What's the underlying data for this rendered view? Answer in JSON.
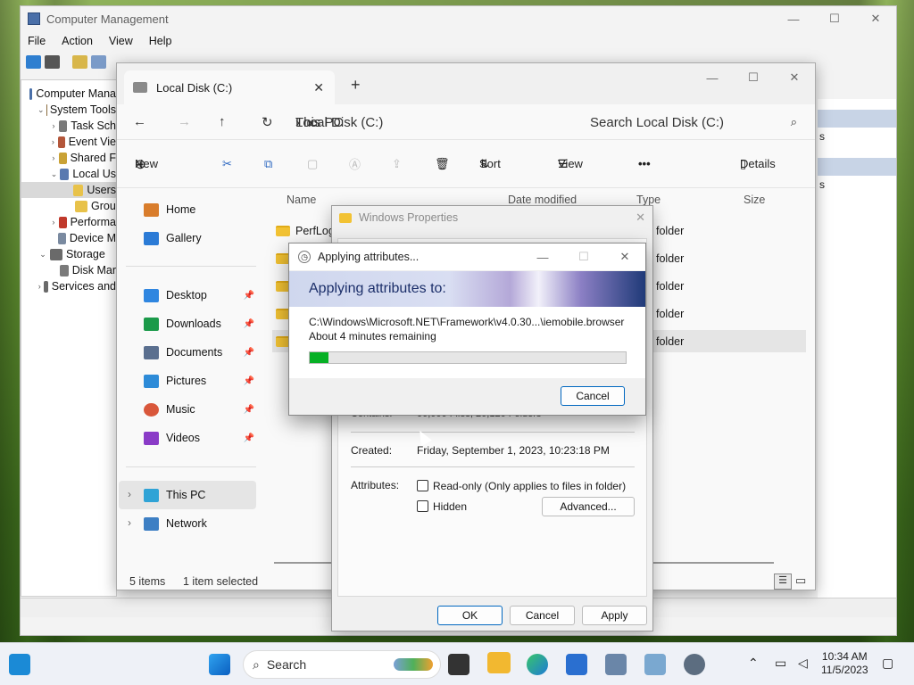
{
  "computer_management": {
    "title": "Computer Management",
    "menu": [
      "File",
      "Action",
      "View",
      "Help"
    ],
    "tree": [
      {
        "label": "Computer Mana",
        "indent": 0,
        "tw": ""
      },
      {
        "label": "System Tools",
        "indent": 1,
        "tw": "⌄"
      },
      {
        "label": "Task Sch",
        "indent": 2,
        "tw": "›"
      },
      {
        "label": "Event Vie",
        "indent": 2,
        "tw": "›"
      },
      {
        "label": "Shared F",
        "indent": 2,
        "tw": "›"
      },
      {
        "label": "Local Us",
        "indent": 2,
        "tw": "⌄"
      },
      {
        "label": "Users",
        "indent": 3,
        "tw": ""
      },
      {
        "label": "Grou",
        "indent": 3,
        "tw": ""
      },
      {
        "label": "Performa",
        "indent": 2,
        "tw": "›"
      },
      {
        "label": "Device M",
        "indent": 2,
        "tw": ""
      },
      {
        "label": "Storage",
        "indent": 1,
        "tw": "⌄"
      },
      {
        "label": "Disk Mar",
        "indent": 2,
        "tw": ""
      },
      {
        "label": "Services and",
        "indent": 1,
        "tw": "›"
      }
    ],
    "right_pane": [
      "s",
      "s"
    ]
  },
  "explorer": {
    "tab_title": "Local Disk (C:)",
    "breadcrumb": [
      "This PC",
      "Local Disk (C:)"
    ],
    "search_placeholder": "Search Local Disk (C:)",
    "commands": {
      "new": "New",
      "sort": "Sort",
      "view": "View",
      "details": "Details",
      "more": "•••"
    },
    "nav": {
      "home": "Home",
      "gallery": "Gallery",
      "desktop": "Desktop",
      "downloads": "Downloads",
      "documents": "Documents",
      "pictures": "Pictures",
      "music": "Music",
      "videos": "Videos",
      "this_pc": "This PC",
      "network": "Network"
    },
    "columns": {
      "name": "Name",
      "date": "Date modified",
      "type": "Type",
      "size": "Size"
    },
    "rows": [
      {
        "name": "PerfLogs",
        "type": "folder"
      },
      {
        "name": "",
        "type": "folder"
      },
      {
        "name": "",
        "type": "folder"
      },
      {
        "name": "",
        "type": "folder"
      },
      {
        "name": "",
        "type": "folder"
      }
    ],
    "status": {
      "items": "5 items",
      "selected": "1 item selected"
    }
  },
  "properties": {
    "title": "Windows Properties",
    "contains_label": "Contains:",
    "contains_value": "00,000 Files, 20,120 Folders",
    "created_label": "Created:",
    "created_value": "Friday, September 1, 2023, 10:23:18 PM",
    "attributes_label": "Attributes:",
    "readonly_label": "Read-only (Only applies to files in folder)",
    "hidden_label": "Hidden",
    "advanced": "Advanced...",
    "ok": "OK",
    "cancel": "Cancel",
    "apply": "Apply"
  },
  "progress_dialog": {
    "title": "Applying attributes...",
    "heading": "Applying attributes to:",
    "path": "C:\\Windows\\Microsoft.NET\\Framework\\v4.0.30...\\iemobile.browser",
    "remaining": "About 4 minutes remaining",
    "progress_fraction": 0.06,
    "cancel": "Cancel"
  },
  "taskbar": {
    "search": "Search",
    "time": "10:34 AM",
    "date": "11/5/2023"
  },
  "colors": {
    "progress": "#06b025",
    "accent": "#0067c0"
  }
}
